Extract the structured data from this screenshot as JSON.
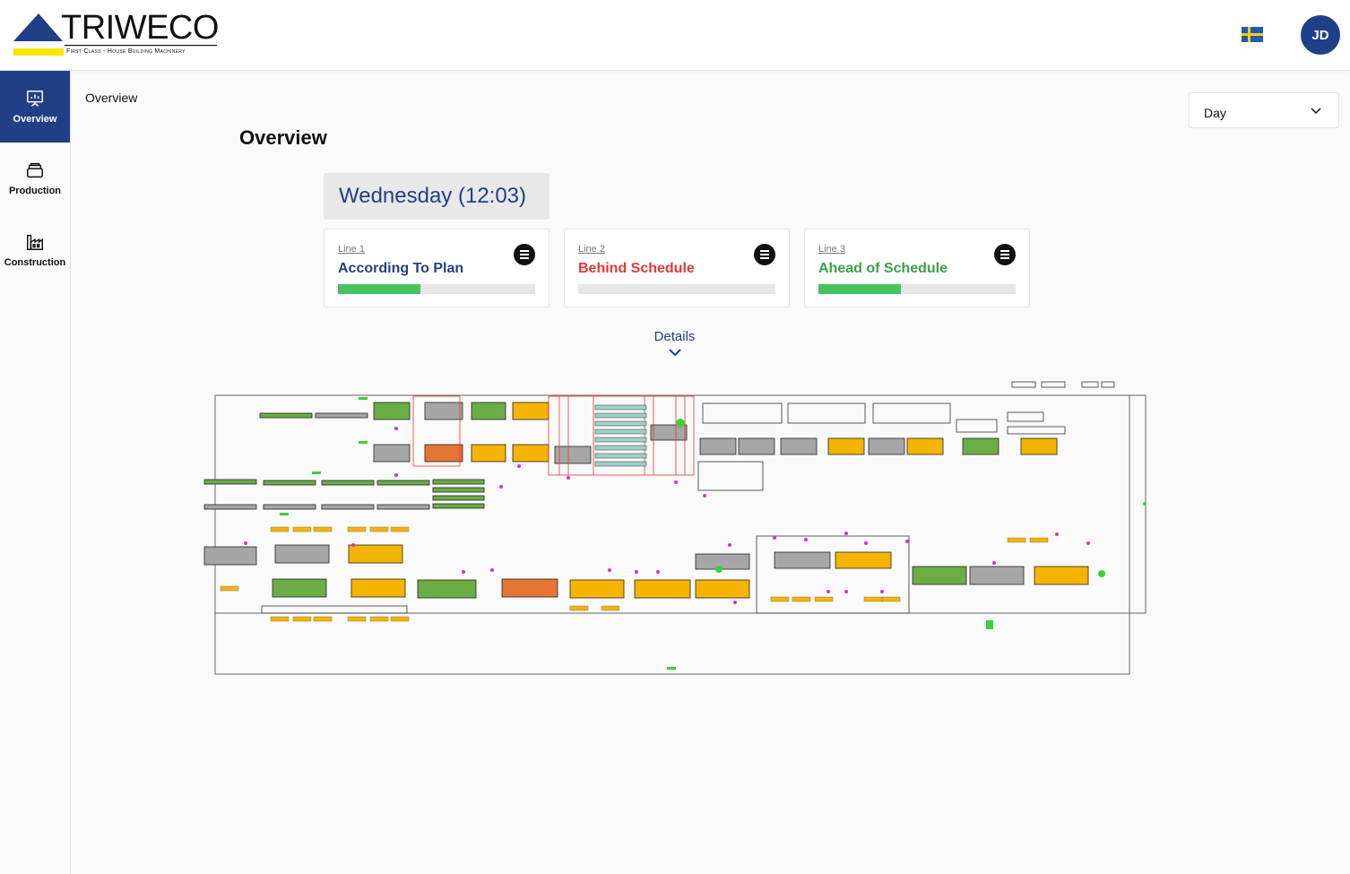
{
  "header": {
    "logo_text": "TRIWECO",
    "logo_tagline": "First Class - House Building Machinery",
    "flag": "sweden-flag-icon",
    "avatar_initials": "JD"
  },
  "sidebar": {
    "items": [
      {
        "label": "Overview",
        "icon": "presentation-chart-icon",
        "active": true
      },
      {
        "label": "Production",
        "icon": "layers-icon",
        "active": false
      },
      {
        "label": "Construction",
        "icon": "factory-icon",
        "active": false
      }
    ]
  },
  "breadcrumb": "Overview",
  "period_select": {
    "value": "Day"
  },
  "page_title": "Overview",
  "day_label": "Wednesday (12:03)",
  "lines": [
    {
      "name": "Line 1",
      "status": "According To Plan",
      "status_color": "#213f87",
      "progress": 0.42
    },
    {
      "name": "Line 2",
      "status": "Behind Schedule",
      "status_color": "#e53935",
      "progress": 0.0
    },
    {
      "name": "Line 3",
      "status": "Ahead of Schedule",
      "status_color": "#3aa14a",
      "progress": 0.42
    }
  ],
  "details_label": "Details",
  "colors": {
    "accent": "#213f87",
    "progress": "#46c35f",
    "station_green": "#6aad44",
    "station_yellow": "#f5b400",
    "station_orange": "#e57534",
    "station_gray": "#a6a6a6"
  }
}
